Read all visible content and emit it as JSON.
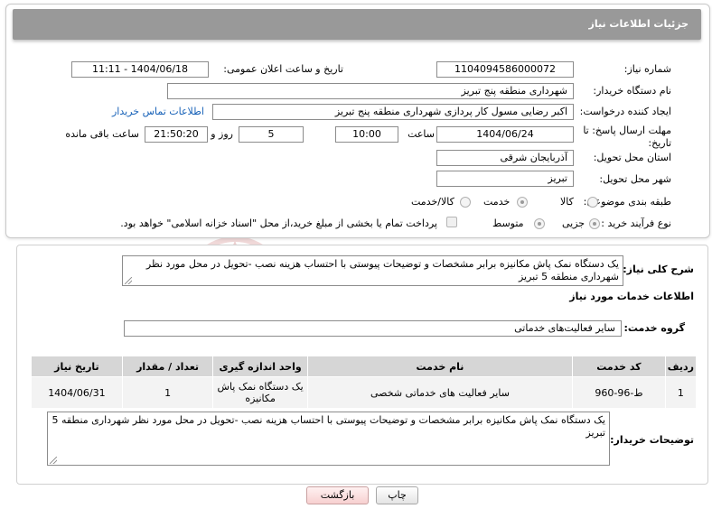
{
  "header": {
    "title": "جزئیات اطلاعات نیاز"
  },
  "fields": {
    "need_number": {
      "label": "شماره نیاز:",
      "value": "1104094586000072"
    },
    "announce_datetime": {
      "label": "تاریخ و ساعت اعلان عمومی:",
      "value": "1404/06/18 - 11:11"
    },
    "buyer_org": {
      "label": "نام دستگاه خریدار:",
      "value": "شهرداری منطقه پنج تبریز"
    },
    "requester": {
      "label": "ایجاد کننده درخواست:",
      "value": "اکبر رضایی مسول کار پردازی شهرداری منطقه پنج تبریز"
    },
    "buyer_contact_link": "اطلاعات تماس خریدار",
    "deadline": {
      "label": "مهلت ارسال پاسخ: تا تاریخ:",
      "date": "1404/06/24",
      "time_label": "ساعت",
      "time": "10:00",
      "days": "5",
      "days_label": "روز و",
      "remaining": "21:50:20",
      "remaining_label": "ساعت باقی مانده"
    },
    "delivery_province": {
      "label": "استان محل تحویل:",
      "value": "آذربایجان شرقی"
    },
    "delivery_city": {
      "label": "شهر محل تحویل:",
      "value": "تبریز"
    },
    "category": {
      "label": "طبقه بندی موضوعی:",
      "options": [
        "کالا",
        "خدمت",
        "کالا/خدمت"
      ],
      "selected": "خدمت"
    },
    "purchase_type": {
      "label": "نوع فرآیند خرید :",
      "options": [
        "جزیی",
        "متوسط"
      ],
      "selected": "جزیی",
      "treasury_note": "پرداخت تمام یا بخشی از مبلغ خرید،از محل \"اسناد خزانه اسلامی\" خواهد بود."
    }
  },
  "summary": {
    "label": "شرح کلی نیاز:",
    "text": "یک دستگاه نمک پاش مکانیزه برابر مشخصات و توضیحات پیوستی با احتساب هزینه نصب -تحویل در محل مورد نظر شهرداری منطقه 5 تبریز"
  },
  "services": {
    "section_title": "اطلاعات خدمات مورد نیاز",
    "group_label": "گروه خدمت:",
    "group_value": "سایر فعالیت‌های خدماتی",
    "table": {
      "headers": [
        "ردیف",
        "کد خدمت",
        "نام خدمت",
        "واحد اندازه گیری",
        "تعداد / مقدار",
        "تاریخ نیاز"
      ],
      "rows": [
        [
          "1",
          "ط-96-960",
          "سایر فعالیت های خدماتی شخصی",
          "یک دستگاه نمک پاش مکانیزه",
          "1",
          "1404/06/31"
        ]
      ]
    }
  },
  "buyer_notes": {
    "label": "توضیحات خریدار:",
    "text": "یک دستگاه نمک پاش مکانیزه برابر مشخصات و توضیحات پیوستی با احتساب هزینه نصب -تحویل در محل مورد نظر شهرداری منطقه 5 تبریز"
  },
  "buttons": {
    "print": "چاپ",
    "back": "بازگشت"
  },
  "watermark": {
    "brand": "AriaTender.neT",
    "color": "#e9c7c7"
  }
}
